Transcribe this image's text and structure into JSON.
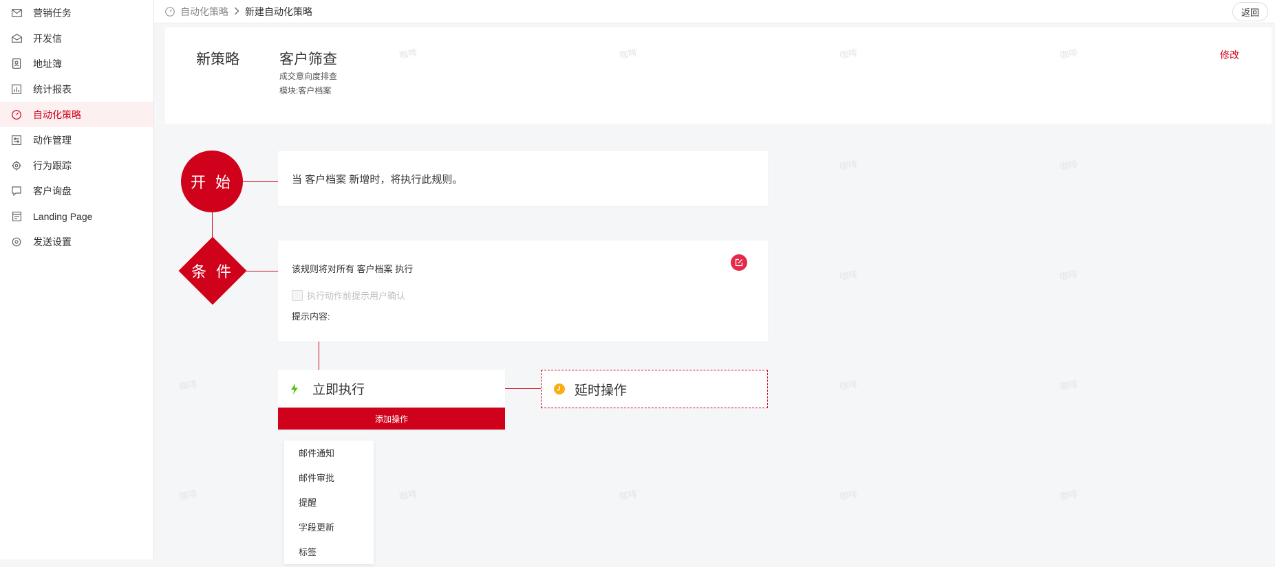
{
  "sidebar": {
    "items": [
      {
        "label": "营销任务",
        "icon": "mail-icon"
      },
      {
        "label": "开发信",
        "icon": "open-mail-icon"
      },
      {
        "label": "地址簿",
        "icon": "address-book-icon"
      },
      {
        "label": "统计报表",
        "icon": "chart-icon"
      },
      {
        "label": "自动化策略",
        "icon": "gauge-icon",
        "active": true
      },
      {
        "label": "动作管理",
        "icon": "settings-list-icon"
      },
      {
        "label": "行为跟踪",
        "icon": "target-icon"
      },
      {
        "label": "客户询盘",
        "icon": "chat-icon"
      },
      {
        "label": "Landing Page",
        "icon": "page-icon"
      },
      {
        "label": "发送设置",
        "icon": "gear-icon"
      }
    ]
  },
  "topbar": {
    "crumb_parent": "自动化策略",
    "crumb_current": "新建自动化策略",
    "back_label": "返回"
  },
  "header": {
    "name": "新策略",
    "title": "客户筛查",
    "subtitle": "成交意向度排查",
    "module": "模块:客户档案",
    "edit_label": "修改"
  },
  "watermark": "咖啡",
  "flow": {
    "start_label": "开 始",
    "start_text": "当 客户档案 新增时，将执行此规则。",
    "condition_label": "条 件",
    "condition_text": "该规则将对所有 客户档案 执行",
    "confirm_label": "执行动作前提示用户确认",
    "prompt_label": "提示内容:",
    "exec_title": "立即执行",
    "add_action_label": "添加操作",
    "delay_title": "延时操作",
    "action_menu": [
      "邮件通知",
      "邮件审批",
      "提醒",
      "字段更新",
      "标签"
    ]
  },
  "colors": {
    "accent": "#d0021b",
    "bolt": "#52c41a",
    "clock": "#faad14"
  }
}
